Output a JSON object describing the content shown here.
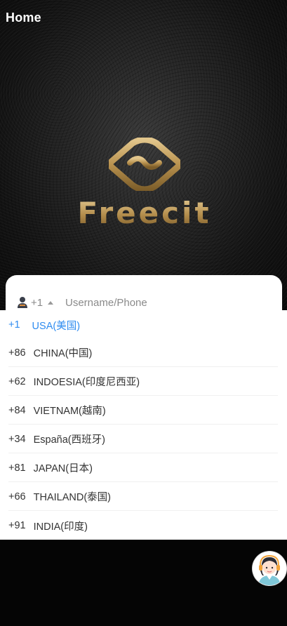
{
  "header": {
    "title": "Home"
  },
  "brand": {
    "name": "Freecit",
    "accent": "#b08a4a"
  },
  "login": {
    "country_code": "+1",
    "user_icon": "user-icon",
    "username_placeholder": "Username/Phone"
  },
  "country_list": {
    "selected_color": "#2f8cf0",
    "items": [
      {
        "code": "+1",
        "name": "USA(美国)",
        "selected": true
      },
      {
        "code": "+86",
        "name": "CHINA(中国)"
      },
      {
        "code": "+62",
        "name": "INDOESIA(印度尼西亚)"
      },
      {
        "code": "+84",
        "name": "VIETNAM(越南)"
      },
      {
        "code": "+34",
        "name": "España(西班牙)"
      },
      {
        "code": "+81",
        "name": "JAPAN(日本)"
      },
      {
        "code": "+66",
        "name": "THAILAND(泰国)"
      },
      {
        "code": "+91",
        "name": "INDIA(印度)"
      }
    ]
  },
  "support": {
    "icon": "customer-service-avatar-icon"
  }
}
